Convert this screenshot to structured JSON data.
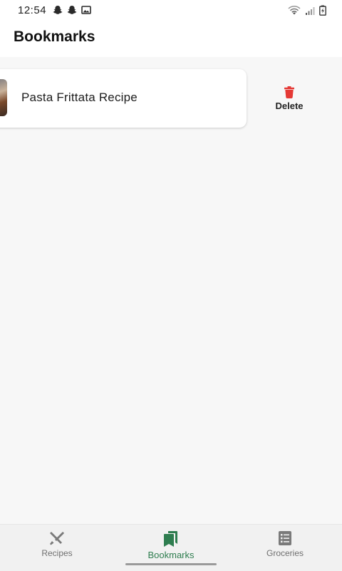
{
  "status_bar": {
    "time": "12:54",
    "left_icons": [
      "snapchat-icon",
      "snapchat-icon",
      "image-icon"
    ],
    "right_icons": [
      "wifi-icon",
      "signal-icon",
      "battery-icon"
    ]
  },
  "app_bar": {
    "title": "Bookmarks"
  },
  "bookmarks": [
    {
      "title": "Pasta Frittata Recipe",
      "thumbnail": "pasta-frittata-photo"
    }
  ],
  "swipe_action": {
    "label": "Delete",
    "icon": "trash-icon",
    "color": "#e53935"
  },
  "bottom_nav": {
    "items": [
      {
        "label": "Recipes",
        "icon": "utensils-icon",
        "active": false
      },
      {
        "label": "Bookmarks",
        "icon": "bookmarks-icon",
        "active": true
      },
      {
        "label": "Groceries",
        "icon": "list-icon",
        "active": false
      }
    ],
    "active_color": "#2e7d4f",
    "inactive_color": "#6f6f6f"
  }
}
